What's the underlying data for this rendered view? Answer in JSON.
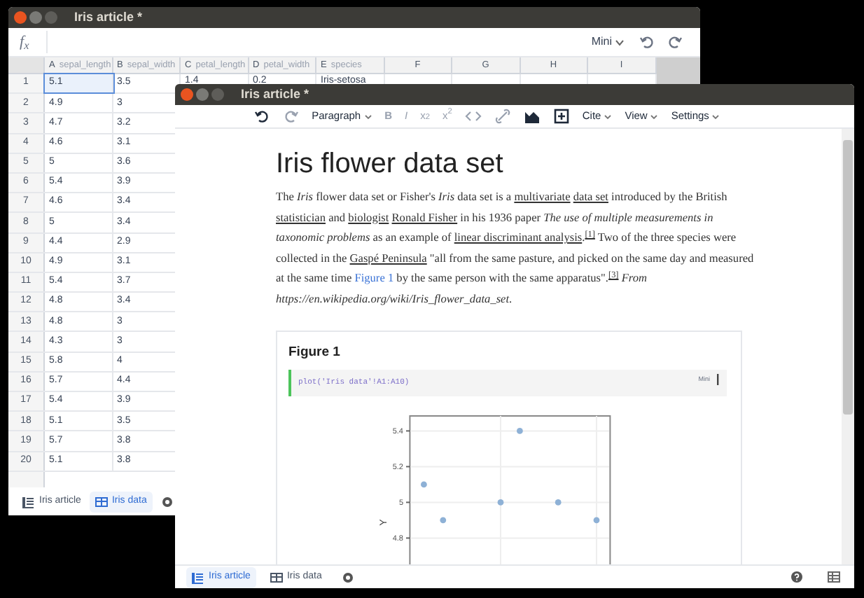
{
  "sheet_window": {
    "title": "Iris article *",
    "formula_bar": {
      "label": "f$_{x}$",
      "mode": "Mini"
    },
    "columns": [
      {
        "letter": "A",
        "name": "sepal_length"
      },
      {
        "letter": "B",
        "name": "sepal_width"
      },
      {
        "letter": "C",
        "name": "petal_length"
      },
      {
        "letter": "D",
        "name": "petal_width"
      },
      {
        "letter": "E",
        "name": "species"
      },
      {
        "letter": "F"
      },
      {
        "letter": "G"
      },
      {
        "letter": "H"
      },
      {
        "letter": "I"
      }
    ],
    "rows": [
      {
        "number": "1",
        "cells": [
          {
            "text": "5.1",
            "selected": true
          },
          {
            "text": "3.5",
            "selected": false
          },
          {
            "text": "1.4",
            "selected": false
          },
          {
            "text": "0.2",
            "selected": false
          },
          {
            "text": "Iris-setosa",
            "selected": false
          }
        ]
      },
      {
        "number": "2",
        "cells": [
          {
            "text": "4.9",
            "selected": false
          },
          {
            "text": "3",
            "selected": false
          }
        ]
      },
      {
        "number": "3",
        "cells": [
          {
            "text": "4.7",
            "selected": false
          },
          {
            "text": "3.2",
            "selected": false
          }
        ]
      },
      {
        "number": "4",
        "cells": [
          {
            "text": "4.6",
            "selected": false
          },
          {
            "text": "3.1",
            "selected": false
          }
        ]
      },
      {
        "number": "5",
        "cells": [
          {
            "text": "5",
            "selected": false
          },
          {
            "text": "3.6",
            "selected": false
          }
        ]
      },
      {
        "number": "6",
        "cells": [
          {
            "text": "5.4",
            "selected": false
          },
          {
            "text": "3.9",
            "selected": false
          }
        ]
      },
      {
        "number": "7",
        "cells": [
          {
            "text": "4.6",
            "selected": false
          },
          {
            "text": "3.4",
            "selected": false
          }
        ]
      },
      {
        "number": "8",
        "cells": [
          {
            "text": "5",
            "selected": false
          },
          {
            "text": "3.4",
            "selected": false
          }
        ]
      },
      {
        "number": "9",
        "cells": [
          {
            "text": "4.4",
            "selected": false
          },
          {
            "text": "2.9",
            "selected": false
          }
        ]
      },
      {
        "number": "10",
        "cells": [
          {
            "text": "4.9",
            "selected": false
          },
          {
            "text": "3.1",
            "selected": false
          }
        ]
      },
      {
        "number": "11",
        "cells": [
          {
            "text": "5.4",
            "selected": false
          },
          {
            "text": "3.7",
            "selected": false
          }
        ]
      },
      {
        "number": "12",
        "cells": [
          {
            "text": "4.8",
            "selected": false
          },
          {
            "text": "3.4",
            "selected": false
          }
        ]
      },
      {
        "number": "13",
        "cells": [
          {
            "text": "4.8",
            "selected": false
          },
          {
            "text": "3",
            "selected": false
          }
        ]
      },
      {
        "number": "14",
        "cells": [
          {
            "text": "4.3",
            "selected": false
          },
          {
            "text": "3",
            "selected": false
          }
        ]
      },
      {
        "number": "15",
        "cells": [
          {
            "text": "5.8",
            "selected": false
          },
          {
            "text": "4",
            "selected": false
          }
        ]
      },
      {
        "number": "16",
        "cells": [
          {
            "text": "5.7",
            "selected": false
          },
          {
            "text": "4.4",
            "selected": false
          }
        ]
      },
      {
        "number": "17",
        "cells": [
          {
            "text": "5.4",
            "selected": false
          },
          {
            "text": "3.9",
            "selected": false
          }
        ]
      },
      {
        "number": "18",
        "cells": [
          {
            "text": "5.1",
            "selected": false
          },
          {
            "text": "3.5",
            "selected": false
          }
        ]
      },
      {
        "number": "19",
        "cells": [
          {
            "text": "5.7",
            "selected": false
          },
          {
            "text": "3.8",
            "selected": false
          }
        ]
      },
      {
        "number": "20",
        "cells": [
          {
            "text": "5.1",
            "selected": false
          },
          {
            "text": "3.8",
            "selected": false
          }
        ]
      }
    ],
    "tabs": [
      {
        "label": "Iris article",
        "kind": "article",
        "selected": false
      },
      {
        "label": "Iris data",
        "kind": "sheet",
        "selected": true
      }
    ]
  },
  "article_window": {
    "title": "Iris article *",
    "toolbar": [
      {
        "kind": "undo",
        "disabled": false
      },
      {
        "kind": "redo",
        "disabled": true
      },
      {
        "kind": "dropdown",
        "label": "Paragraph",
        "disabled": false
      },
      {
        "kind": "glyph",
        "label": "B",
        "disabled": true
      },
      {
        "kind": "glyph",
        "label": "I",
        "disabled": true
      },
      {
        "kind": "glyph",
        "label": "x$_{2}$",
        "disabled": true
      },
      {
        "kind": "glyph",
        "label": "x$^{2}$",
        "disabled": true
      },
      {
        "kind": "code",
        "disabled": true
      },
      {
        "kind": "link",
        "disabled": true
      },
      {
        "kind": "image",
        "disabled": false
      },
      {
        "kind": "insert",
        "disabled": false
      },
      {
        "kind": "dropdown",
        "label": "Cite",
        "disabled": false
      },
      {
        "kind": "dropdown",
        "label": "View",
        "disabled": false
      },
      {
        "kind": "dropdown",
        "label": "Settings",
        "disabled": false
      }
    ],
    "heading": "Iris flower data set",
    "paragraph": [
      {
        "kind": "text",
        "text": "The "
      },
      {
        "kind": "emphasis",
        "text": "Iris"
      },
      {
        "kind": "text",
        "text": " flower data set or Fisher's "
      },
      {
        "kind": "emphasis",
        "text": "Iris"
      },
      {
        "kind": "text",
        "text": " data set is a "
      },
      {
        "kind": "link",
        "text": "multivariate"
      },
      {
        "kind": "link",
        "text": "data set"
      },
      {
        "kind": "text",
        "text": " introduced by the British "
      },
      {
        "kind": "link",
        "text": "statistician"
      },
      {
        "kind": "text",
        "text": " and "
      },
      {
        "kind": "link",
        "text": "biologist"
      },
      {
        "kind": "link",
        "text": "Ronald Fisher"
      },
      {
        "kind": "text",
        "text": " in his 1936 paper "
      },
      {
        "kind": "emphasis",
        "text": "The use of multiple measurements in taxonomic problems"
      },
      {
        "kind": "text",
        "text": " as an example of "
      },
      {
        "kind": "link",
        "text": "linear discriminant analysis"
      },
      {
        "kind": "text",
        "text": "."
      },
      {
        "kind": "citation",
        "text": "[1]"
      },
      {
        "kind": "text",
        "text": " Two of the three species were collected in the "
      },
      {
        "kind": "link",
        "text": "Gaspé Peninsula"
      },
      {
        "kind": "text",
        "text": " \"all from the same pasture, and picked on the same day and measured at the same time "
      },
      {
        "kind": "xref",
        "text": "Figure 1"
      },
      {
        "kind": "text",
        "text": " by the same person with the same apparatus\"."
      },
      {
        "kind": "citation",
        "text": "[3]"
      },
      {
        "kind": "emphasis",
        "text": "From https://en.wikipedia.org/wiki/Iris_flower_data_set"
      },
      {
        "kind": "text",
        "text": "."
      }
    ],
    "figure": {
      "title": "Figure 1",
      "code": "plot('Iris data'!A1:A10)",
      "mode": "Mini",
      "y_axis_label": "Y",
      "y_ticks": [
        "5.4",
        "5.2",
        "5",
        "4.8"
      ]
    },
    "tabs": [
      {
        "label": "Iris article",
        "kind": "article",
        "selected": true
      },
      {
        "label": "Iris data",
        "kind": "sheet",
        "selected": false
      }
    ]
  }
}
